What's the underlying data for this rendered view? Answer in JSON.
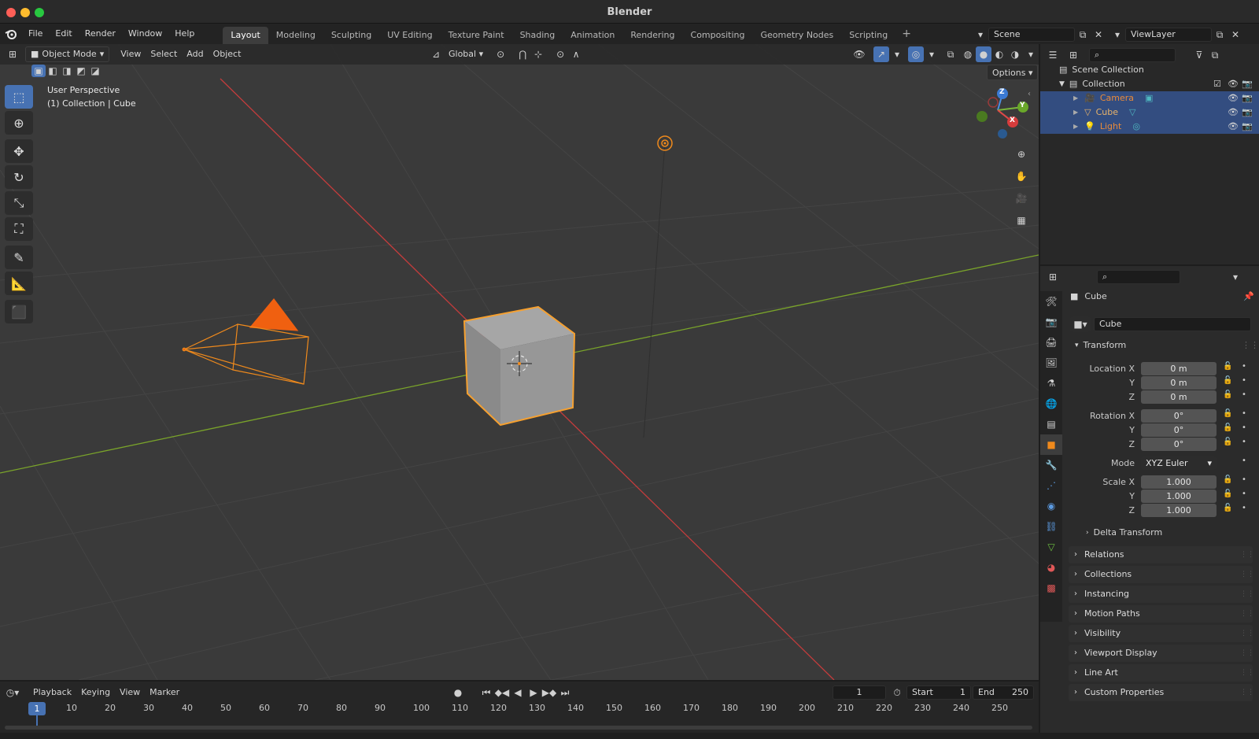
{
  "window": {
    "title": "Blender"
  },
  "menu": [
    "File",
    "Edit",
    "Render",
    "Window",
    "Help"
  ],
  "workspaces": [
    {
      "label": "Layout",
      "active": true
    },
    {
      "label": "Modeling"
    },
    {
      "label": "Sculpting"
    },
    {
      "label": "UV Editing"
    },
    {
      "label": "Texture Paint"
    },
    {
      "label": "Shading"
    },
    {
      "label": "Animation"
    },
    {
      "label": "Rendering"
    },
    {
      "label": "Compositing"
    },
    {
      "label": "Geometry Nodes"
    },
    {
      "label": "Scripting"
    }
  ],
  "add_workspace": "+",
  "scene": {
    "name": "Scene",
    "view_layer": "ViewLayer"
  },
  "viewport": {
    "mode": "Object Mode",
    "menus": [
      "View",
      "Select",
      "Add",
      "Object"
    ],
    "orientation": "Global",
    "options": "Options",
    "overlay_line1": "User Perspective",
    "overlay_line2": "(1) Collection | Cube",
    "gizmo": {
      "z": "Z",
      "y": "Y",
      "x": "X"
    }
  },
  "outliner": {
    "scene_collection": "Scene Collection",
    "collection": "Collection",
    "items": [
      {
        "name": "Camera",
        "color": "#e88a3a"
      },
      {
        "name": "Cube",
        "color": "#e8b36a"
      },
      {
        "name": "Light",
        "color": "#e88a3a"
      }
    ]
  },
  "properties": {
    "object_name": "Cube",
    "data_name": "Cube",
    "transform_label": "Transform",
    "location": {
      "label": "Location X",
      "x": "0 m",
      "y": "0 m",
      "z": "0 m"
    },
    "rotation": {
      "label": "Rotation X",
      "x": "0°",
      "y": "0°",
      "z": "0°"
    },
    "mode_label": "Mode",
    "mode_value": "XYZ Euler",
    "scale": {
      "label": "Scale X",
      "x": "1.000",
      "y": "1.000",
      "z": "1.000"
    },
    "axis_y": "Y",
    "axis_z": "Z",
    "delta": "Delta Transform",
    "panels": [
      "Relations",
      "Collections",
      "Instancing",
      "Motion Paths",
      "Visibility",
      "Viewport Display",
      "Line Art",
      "Custom Properties"
    ]
  },
  "timeline": {
    "menus": [
      "Playback",
      "Keying",
      "View",
      "Marker"
    ],
    "current_frame": "1",
    "start_label": "Start",
    "start_value": "1",
    "end_label": "End",
    "end_value": "250",
    "current_marker": "1",
    "ticks": [
      "10",
      "20",
      "30",
      "40",
      "50",
      "60",
      "70",
      "80",
      "90",
      "100",
      "110",
      "120",
      "130",
      "140",
      "150",
      "160",
      "170",
      "180",
      "190",
      "200",
      "210",
      "220",
      "230",
      "240",
      "250"
    ]
  },
  "colors": {
    "accent": "#4772b3",
    "selection_orange": "#f08a1c",
    "x_axis": "#c43c3c",
    "y_axis": "#7aa42a"
  }
}
